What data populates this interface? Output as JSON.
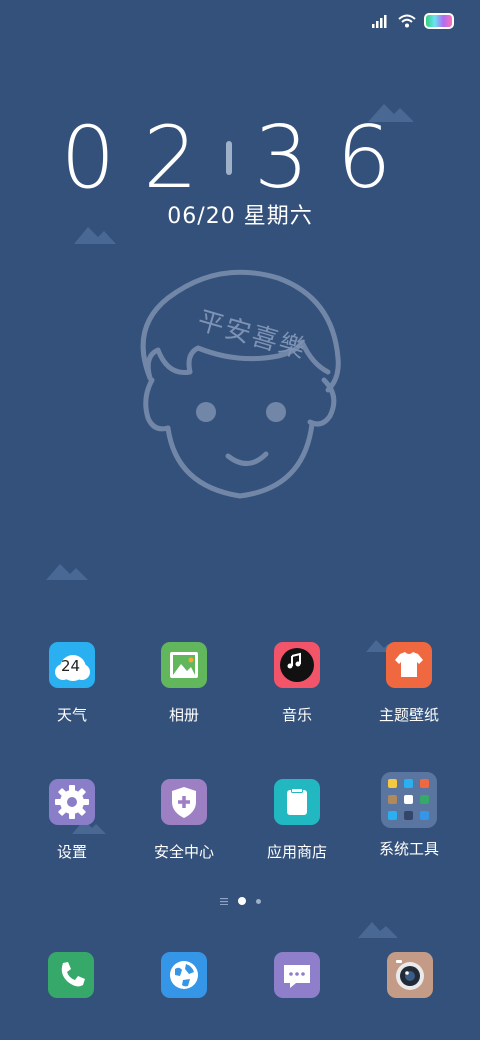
{
  "status_bar": {
    "signal_icon": "signal-bars-icon",
    "wifi_icon": "wifi-icon",
    "battery_icon": "battery-icon"
  },
  "lockscreen": {
    "hour": "02",
    "minute": "36",
    "date": "06/20 星期六"
  },
  "wallpaper": {
    "caption": "平安喜樂"
  },
  "apps_row1": [
    {
      "label": "天气",
      "icon": "weather-icon",
      "icon_text": "24"
    },
    {
      "label": "相册",
      "icon": "gallery-icon"
    },
    {
      "label": "音乐",
      "icon": "music-icon"
    },
    {
      "label": "主题壁纸",
      "icon": "themes-icon"
    }
  ],
  "apps_row2": [
    {
      "label": "设置",
      "icon": "settings-icon"
    },
    {
      "label": "安全中心",
      "icon": "security-icon"
    },
    {
      "label": "应用商店",
      "icon": "app-store-icon"
    },
    {
      "label": "系统工具",
      "icon": "tools-folder-icon"
    }
  ],
  "page_indicator": {
    "pages": 2,
    "current": 1
  },
  "dock": [
    {
      "icon": "phone-icon"
    },
    {
      "icon": "browser-icon"
    },
    {
      "icon": "messages-icon"
    },
    {
      "icon": "camera-icon"
    }
  ],
  "colors": {
    "background": "#33517a",
    "weather": "#2ab0f0",
    "gallery": "#62b65b",
    "music": "#f2546a",
    "themes": "#f0683f",
    "settings": "#8a7ec8",
    "security": "#9d7fc4",
    "store": "#21b8c2",
    "phone": "#36a86a",
    "browser": "#3596e8",
    "messages": "#8f7fcb",
    "camera": "#c39b86"
  }
}
